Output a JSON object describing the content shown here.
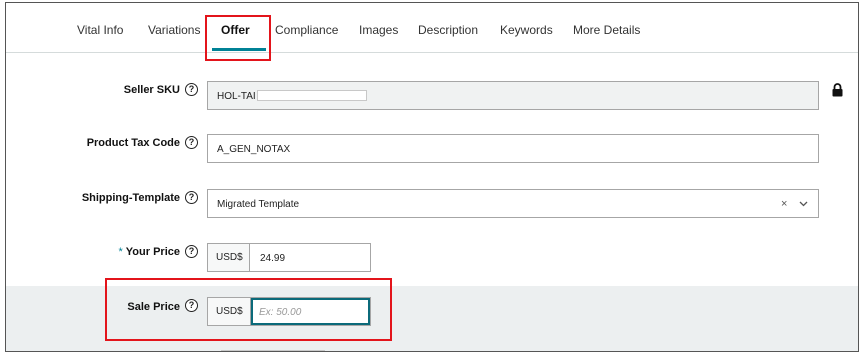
{
  "tabs": {
    "items": [
      {
        "label": "Vital Info"
      },
      {
        "label": "Variations"
      },
      {
        "label": "Offer"
      },
      {
        "label": "Compliance"
      },
      {
        "label": "Images"
      },
      {
        "label": "Description"
      },
      {
        "label": "Keywords"
      },
      {
        "label": "More Details"
      }
    ],
    "active": "Offer"
  },
  "form": {
    "seller_sku": {
      "label": "Seller SKU",
      "value": "HOL-TAI",
      "locked": true
    },
    "product_tax_code": {
      "label": "Product Tax Code",
      "value": "A_GEN_NOTAX"
    },
    "shipping_template": {
      "label": "Shipping-Template",
      "value": "Migrated Template",
      "clear": "×"
    },
    "your_price": {
      "label": "Your Price",
      "required_mark": "*",
      "currency": "USD$",
      "value": "24.99"
    },
    "sale_price": {
      "label": "Sale Price",
      "currency": "USD$",
      "placeholder": "Ex: 50.00"
    }
  },
  "colors": {
    "accent": "#008296",
    "annotation": "#e3141b",
    "highlight_band": "#eceff0"
  },
  "icons": {
    "help": "question-circle-icon",
    "lock": "lock-icon",
    "dropdown": "chevron-down-icon"
  }
}
